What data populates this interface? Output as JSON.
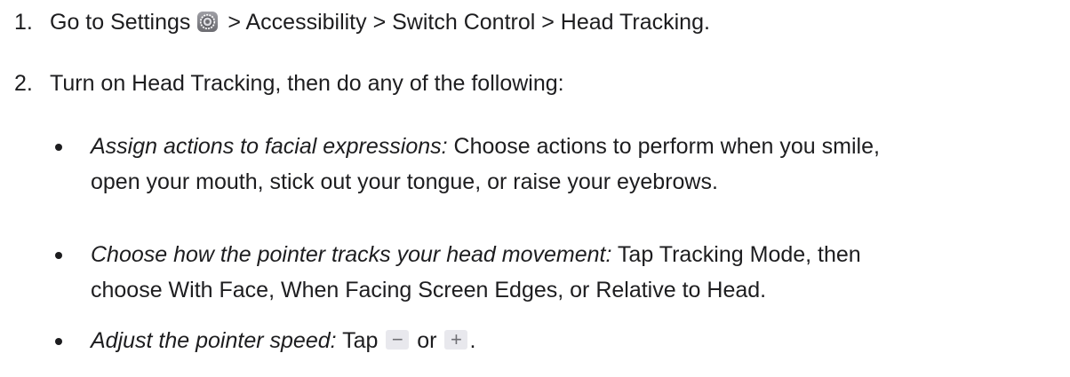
{
  "steps": [
    {
      "number": "1.",
      "text_before_icon": "Go to Settings ",
      "icon": "settings-gear-icon",
      "text_after_icon": " > Accessibility > Switch Control > Head Tracking."
    },
    {
      "number": "2.",
      "text": "Turn on Head Tracking, then do any of the following:"
    }
  ],
  "bullets": [
    {
      "label": "Assign actions to facial expressions:",
      "line1": " Choose actions to perform when you smile,",
      "line2": "open your mouth, stick out your tongue, or raise your eyebrows."
    },
    {
      "label": "Choose how the pointer tracks your head movement:",
      "line1": " Tap Tracking Mode, then",
      "line2": "choose With Face, When Facing Screen Edges, or Relative to Head."
    },
    {
      "label": "Adjust the pointer speed:",
      "text_before": " Tap ",
      "minus_key": "−",
      "text_between": " or ",
      "plus_key": "+",
      "text_after": "."
    }
  ],
  "colors": {
    "text": "#1d1d1f",
    "key_background": "#e8e8ed",
    "key_glyph": "#6e6e73",
    "settings_icon_background": "#8e8e93"
  }
}
